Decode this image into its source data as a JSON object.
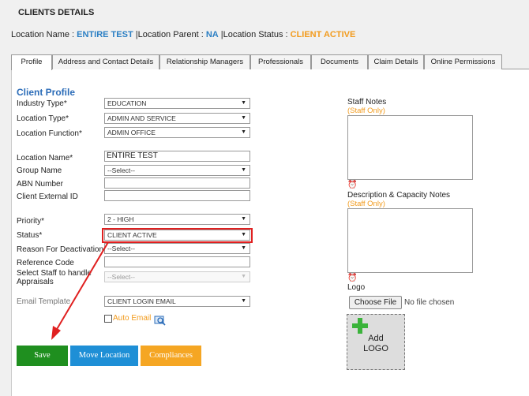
{
  "header": {
    "title": "CLIENTS DETAILS"
  },
  "location": {
    "name_label": "Location Name : ",
    "name_value": "ENTIRE TEST",
    "parent_label": " |Location Parent : ",
    "parent_value": "NA",
    "status_label": " |Location Status : ",
    "status_value": "CLIENT ACTIVE"
  },
  "tabs": [
    {
      "label": "Profile"
    },
    {
      "label": "Address and Contact Details"
    },
    {
      "label": "Relationship Managers"
    },
    {
      "label": "Professionals"
    },
    {
      "label": "Documents"
    },
    {
      "label": "Claim Details"
    },
    {
      "label": "Online Permissions"
    }
  ],
  "profile": {
    "title": "Client Profile",
    "industry_type": {
      "label": "Industry Type*",
      "value": "EDUCATION"
    },
    "location_type": {
      "label": "Location Type*",
      "value": "ADMIN AND SERVICE"
    },
    "location_function": {
      "label": "Location Function*",
      "value": "ADMIN OFFICE"
    },
    "location_name": {
      "label": "Location Name*",
      "value": "ENTIRE TEST"
    },
    "group_name": {
      "label": "Group Name",
      "value": "--Select--"
    },
    "abn_number": {
      "label": "ABN Number",
      "value": ""
    },
    "client_external_id": {
      "label": "Client External ID",
      "value": ""
    },
    "priority": {
      "label": "Priority*",
      "value": "2 - HIGH"
    },
    "status": {
      "label": "Status*",
      "value": "CLIENT ACTIVE"
    },
    "reason": {
      "label": "Reason For Deactivation",
      "value": "--Select--"
    },
    "reference_code": {
      "label": "Reference Code",
      "value": ""
    },
    "staff_appraisals": {
      "label_line1": "Select Staff to handle",
      "label_line2": "Appraisals",
      "value": "--Select--"
    },
    "email_template": {
      "label": "Email Template",
      "value": "CLIENT LOGIN EMAIL"
    },
    "auto_email": {
      "label": "Auto Email"
    }
  },
  "notes": {
    "staff_notes_label": "Staff Notes",
    "staff_only": "(Staff Only)",
    "description_label": "Description & Capacity Notes",
    "description_staff_only": "(Staff Only)",
    "logo_label": "Logo",
    "choose_file": "Choose File",
    "no_file": "No file chosen",
    "add_logo_line1": "Add",
    "add_logo_line2": "LOGO"
  },
  "buttons": {
    "save": "Save",
    "move_location": "Move Location",
    "compliances": "Compliances"
  },
  "colors": {
    "save": "#1f8f1f",
    "move_location": "#1e8fd6",
    "compliances": "#f5a623",
    "highlight": "#e02020"
  }
}
